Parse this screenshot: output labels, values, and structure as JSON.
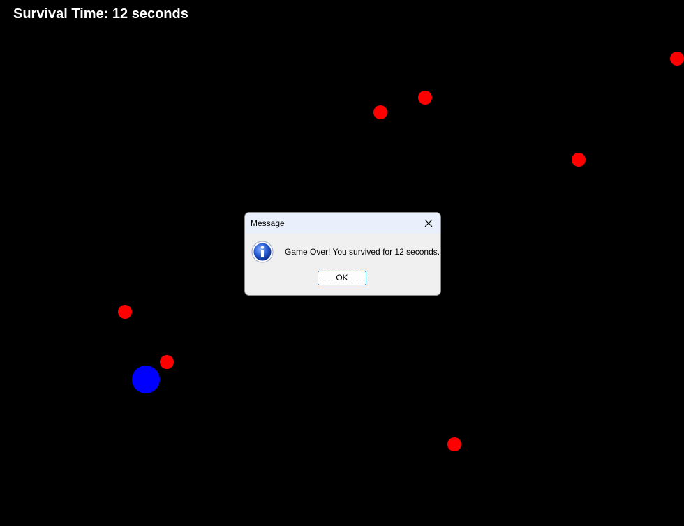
{
  "hud": {
    "survival_label": "Survival Time: 12 seconds"
  },
  "game": {
    "background_color": "#000000",
    "enemy_color": "#ff0000",
    "player_color": "#0000ff",
    "enemy_count": 8,
    "player_count": 1
  },
  "dialog": {
    "title": "Message",
    "icon": "info-icon",
    "close_icon": "close-icon",
    "message": "Game Over! You survived for 12 seconds.",
    "ok_label": "OK"
  }
}
